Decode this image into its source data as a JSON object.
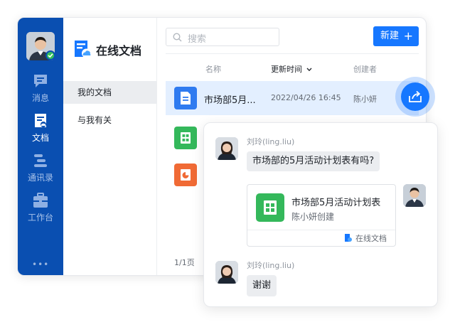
{
  "nav": {
    "items": [
      {
        "label": "消息",
        "icon": "message-icon"
      },
      {
        "label": "文档",
        "icon": "document-icon"
      },
      {
        "label": "通讯录",
        "icon": "contacts-icon"
      },
      {
        "label": "工作台",
        "icon": "workbench-icon"
      }
    ],
    "more": "•••"
  },
  "panel": {
    "title": "在线文档",
    "items": [
      "我的文档",
      "与我有关"
    ]
  },
  "list": {
    "search_placeholder": "搜索",
    "new_button": "新建",
    "new_icon": "+",
    "columns": {
      "name": "名称",
      "updated": "更新时间",
      "creator": "创建者"
    },
    "rows": [
      {
        "name": "市场部5月...",
        "updated": "2022/04/26 16:45",
        "creator": "陈小妍",
        "type": "doc",
        "color": "#2f7bf0"
      },
      {
        "type": "sheet",
        "color": "#34b85b"
      },
      {
        "type": "slide",
        "color": "#f06a35"
      }
    ],
    "pager": "1/1页"
  },
  "chat": {
    "messages": [
      {
        "sender": "刘玲(ling.liu)",
        "text": "市场部的5月活动计划表有吗?"
      },
      {
        "sender": "刘玲(ling.liu)",
        "text": "谢谢"
      }
    ],
    "shared_doc": {
      "title": "市场部5月活动计划表",
      "subtitle": "陈小妍创建",
      "source": "在线文档"
    }
  },
  "colors": {
    "nav": "#0a4fb1",
    "accent": "#1677ff",
    "sheet": "#34b85b",
    "selected_row": "#e3efff"
  }
}
